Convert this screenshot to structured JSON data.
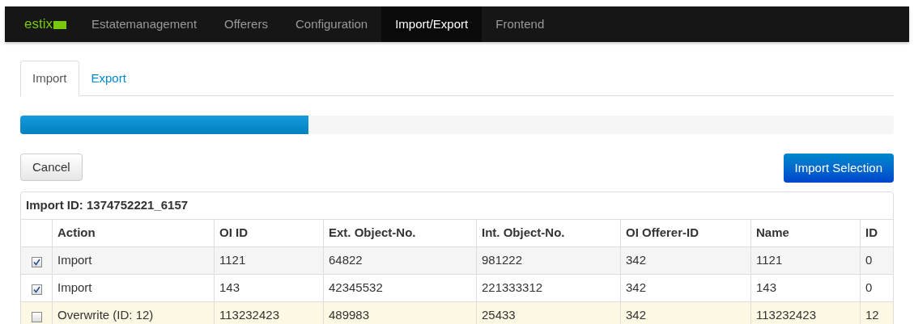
{
  "navbar": {
    "logo": "estix",
    "items": [
      {
        "label": "Estatemanagement",
        "selected": false
      },
      {
        "label": "Offerers",
        "selected": false
      },
      {
        "label": "Configuration",
        "selected": false
      },
      {
        "label": "Import/Export",
        "selected": true
      },
      {
        "label": "Frontend",
        "selected": false
      }
    ]
  },
  "tabs": [
    {
      "label": "Import",
      "selected": true
    },
    {
      "label": "Export",
      "selected": false
    }
  ],
  "progress": {
    "level": 0.33
  },
  "buttons": {
    "cancel": "Cancel",
    "import": "Import Selection"
  },
  "table": {
    "title": "Import ID: 1374752221_6157",
    "columns": [
      "Action",
      "OI ID",
      "Ext. Object-No.",
      "Int. Object-No.",
      "OI Offerer-ID",
      "Name",
      "ID"
    ],
    "rows": [
      {
        "checked": true,
        "warning": false,
        "cells": [
          "Import",
          "1121",
          "64822",
          "981222",
          "342",
          "1121",
          "0"
        ]
      },
      {
        "checked": true,
        "warning": false,
        "cells": [
          "Import",
          "143",
          "42345532",
          "221333312",
          "342",
          "143",
          "0"
        ]
      },
      {
        "checked": false,
        "warning": true,
        "cells": [
          "Overwrite (ID: 12)",
          "113232423",
          "489983",
          "25433",
          "342",
          "113232423",
          "12"
        ]
      }
    ]
  }
}
